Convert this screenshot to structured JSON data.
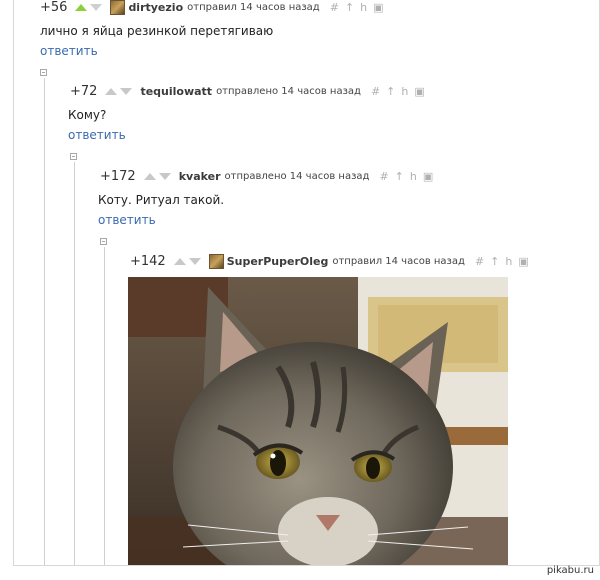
{
  "comments": [
    {
      "rating": "+56",
      "username": "dirtyezio",
      "sent": "отправил 14 часов назад",
      "text": "лично я  яйца резинкой перетягиваю",
      "reply": "ответить"
    },
    {
      "rating": "+72",
      "username": "tequilowatt",
      "sent": "отправлено 14 часов назад",
      "text": "Кому?",
      "reply": "ответить"
    },
    {
      "rating": "+172",
      "username": "kvaker",
      "sent": "отправлено 14 часов назад",
      "text": "Коту. Ритуал такой.",
      "reply": "ответить"
    },
    {
      "rating": "+142",
      "username": "SuperPuperOleg",
      "sent": "отправил 14 часов назад",
      "text": "",
      "reply": ""
    }
  ],
  "icons": [
    "vote-up-icon",
    "vote-down-icon",
    "link-hash-icon",
    "parent-arrow-icon",
    "thread-icon",
    "save-icon"
  ],
  "watermark": "pikabu.ru",
  "colors": {
    "link": "#3a6ab0",
    "vote_up": "#8bd03a",
    "icon": "#b0b0b0"
  }
}
